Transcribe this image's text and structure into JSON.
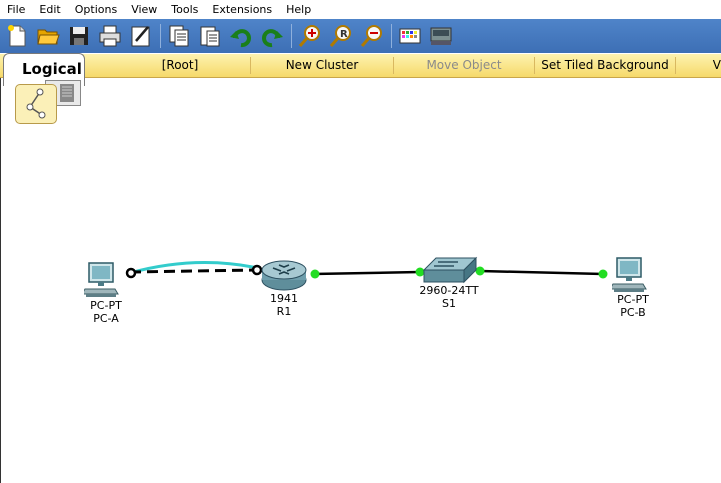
{
  "menu": [
    "File",
    "Edit",
    "Options",
    "View",
    "Tools",
    "Extensions",
    "Help"
  ],
  "toolbar_icons": [
    "new-file-icon",
    "open-folder-icon",
    "save-icon",
    "print-icon",
    "activity-wizard-icon",
    "copy-icon",
    "paste-icon",
    "undo-icon",
    "redo-icon",
    "zoom-in-icon",
    "zoom-reset-icon",
    "zoom-out-icon",
    "palette-icon",
    "custom-device-icon"
  ],
  "logical": {
    "tab_label": "Logical",
    "root": "[Root]",
    "new_cluster": "New Cluster",
    "move_object": "Move Object",
    "set_tiled_background": "Set Tiled Background",
    "extra": "V"
  },
  "devices": {
    "pc_a": {
      "model": "PC-PT",
      "name": "PC-A"
    },
    "r1": {
      "model": "1941",
      "name": "R1"
    },
    "s1": {
      "model": "2960-24TT",
      "name": "S1"
    },
    "pc_b": {
      "model": "PC-PT",
      "name": "PC-B"
    }
  },
  "colors": {
    "toolbar_bg": "#4677be",
    "logical_bar": "#f8e080",
    "link_up": "#22dd22",
    "console_cable": "#33cccc"
  }
}
